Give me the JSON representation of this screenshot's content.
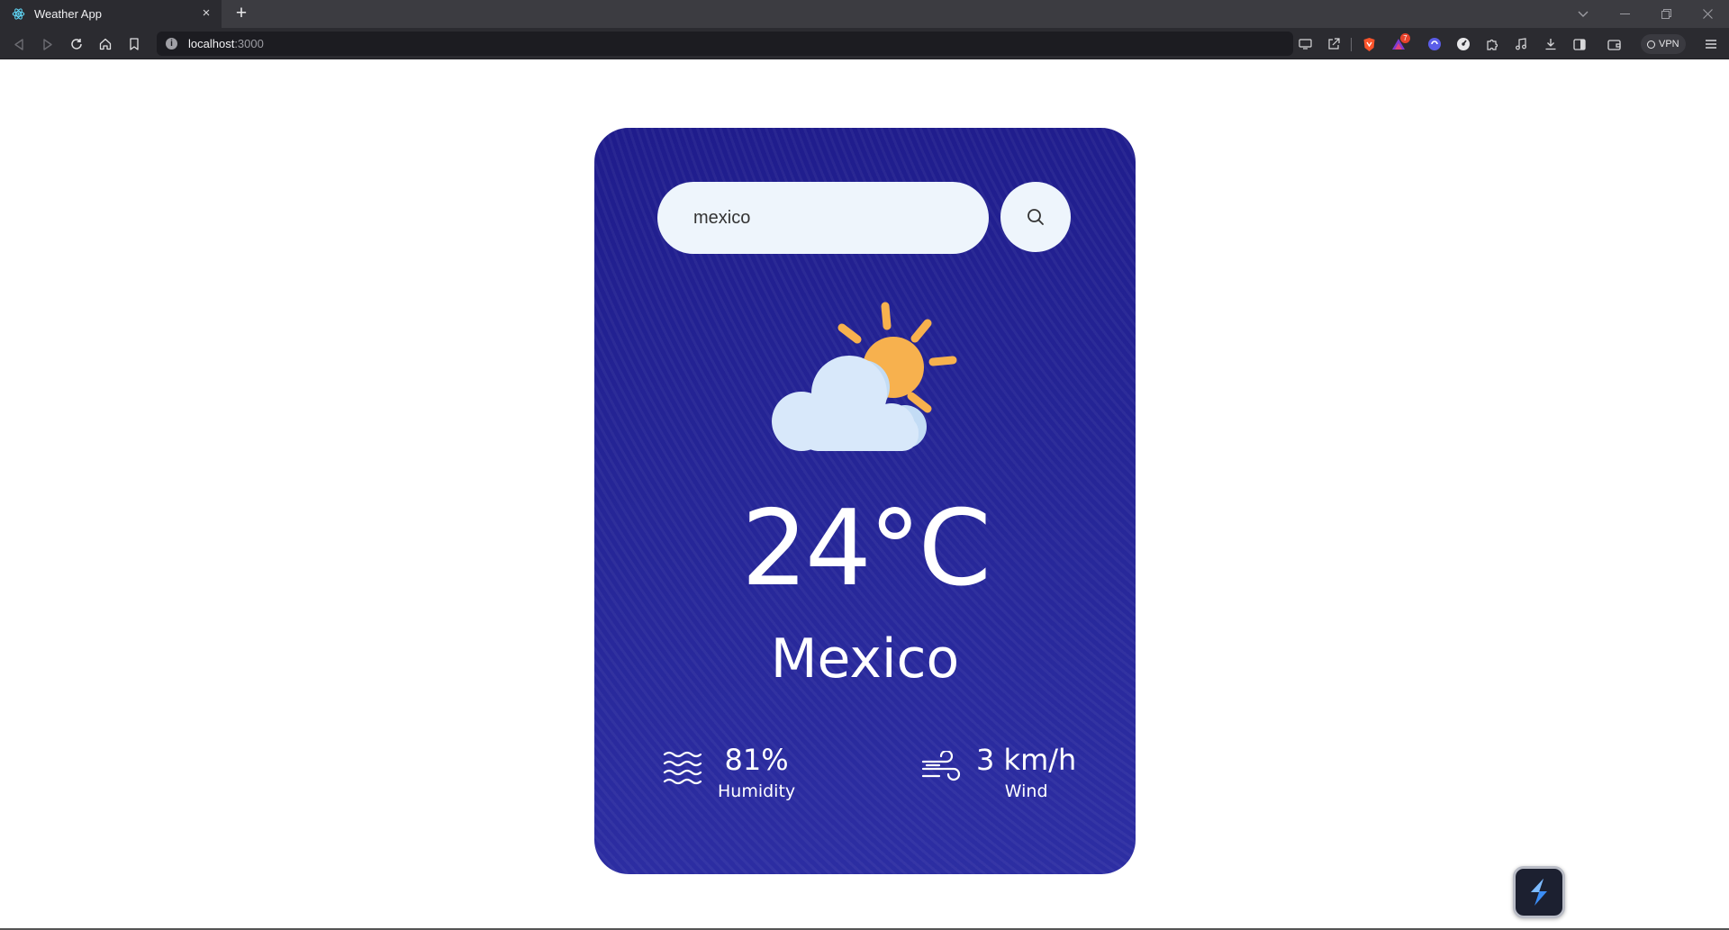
{
  "browser": {
    "tab_title": "Weather App",
    "tab_close": "×",
    "new_tab": "+",
    "url_host": "localhost",
    "url_port": ":3000",
    "notification_count": "7",
    "vpn_label": "VPN"
  },
  "search": {
    "value": "mexico",
    "placeholder": "Search"
  },
  "weather": {
    "icon": "partly-cloudy",
    "temperature": "24°C",
    "city": "Mexico",
    "humidity_value": "81%",
    "humidity_label": "Humidity",
    "wind_value": "3 km/h",
    "wind_label": "Wind"
  },
  "colors": {
    "card_background": "#252596",
    "search_background": "#eef5fc",
    "sun": "#f7b14e",
    "cloud": "#d8e8fa"
  }
}
